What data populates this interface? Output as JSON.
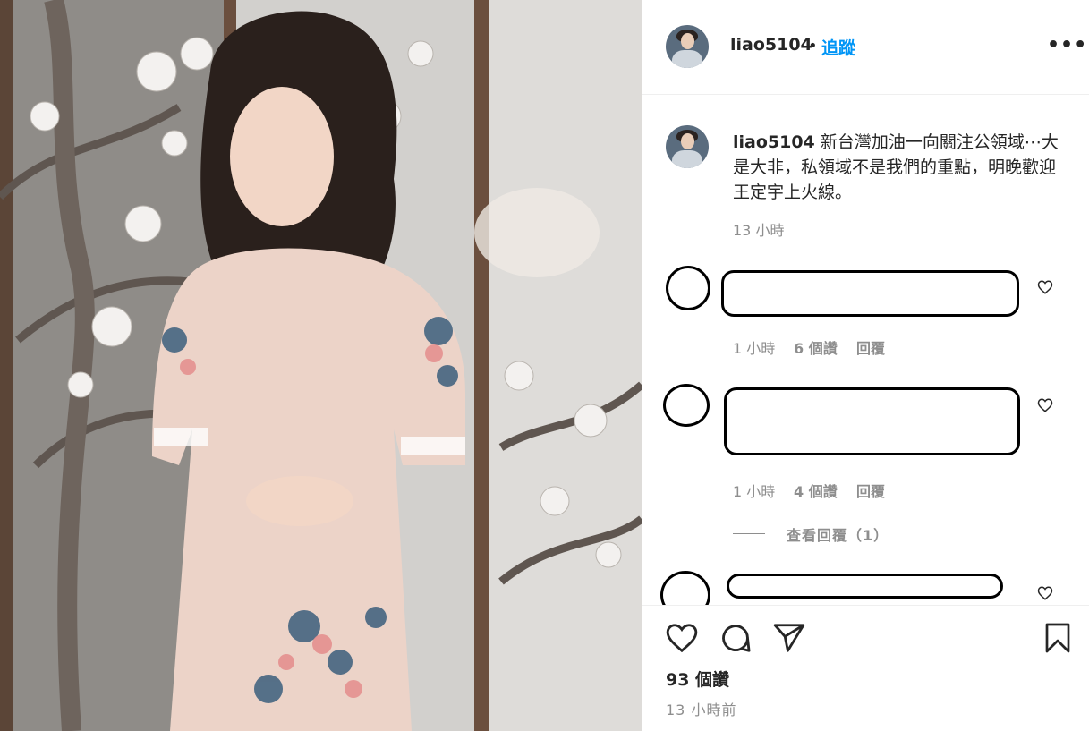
{
  "post": {
    "username": "liao5104",
    "separator": "•",
    "follow_label": "追蹤",
    "more_label": "•••"
  },
  "caption": {
    "username": "liao5104",
    "text": "新台灣加油一向關注公領域⋯大是大非，私領域不是我們的重點，明晚歡迎王定宇上火線。",
    "time": "13 小時"
  },
  "comments": [
    {
      "time": "1 小時",
      "likes": "6 個讚",
      "reply_label": "回覆"
    },
    {
      "time": "1 小時",
      "likes": "4 個讚",
      "reply_label": "回覆",
      "view_replies": "查看回覆（1）"
    }
  ],
  "footer": {
    "likes": "93 個讚",
    "posted": "13 小時前"
  },
  "icons": {
    "heart": "heart-icon",
    "comment": "comment-icon",
    "share": "share-icon",
    "save": "bookmark-icon"
  },
  "colors": {
    "accent": "#0095f6",
    "muted": "#8e8e8e",
    "text": "#262626"
  }
}
